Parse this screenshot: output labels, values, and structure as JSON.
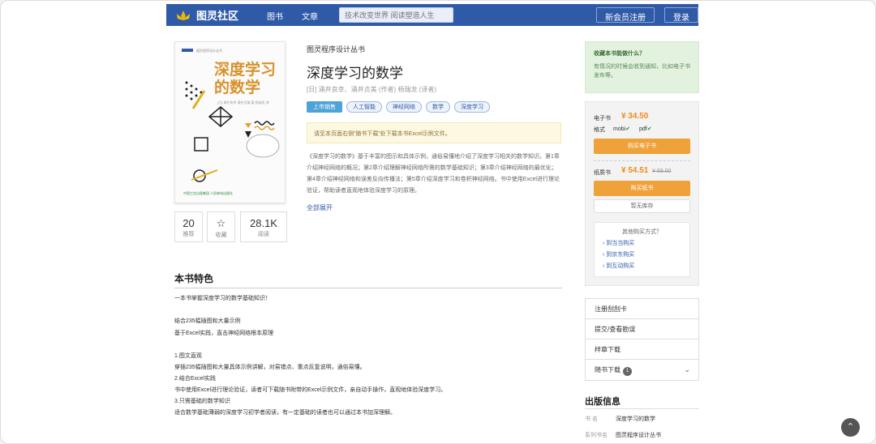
{
  "header": {
    "logo_text": "图灵社区",
    "nav": [
      "图书",
      "文章"
    ],
    "search_placeholder": "技术改变世界 阅读塑造人生",
    "register_label": "新会员注册",
    "login_label": "登录"
  },
  "cover": {
    "series": "图灵程序设计丛书",
    "title_line1": "深度学习",
    "title_line2": "的数学",
    "authors": "[日] 涌井良幸 涌井贞美 著 杨瑞龙 译",
    "publisher": "中国工信出版集团  人民邮电出版社"
  },
  "stats": [
    {
      "value": "20",
      "label": "推荐"
    },
    {
      "value": "☆",
      "label": "收藏"
    },
    {
      "value": "28.1K",
      "label": "阅读"
    }
  ],
  "book": {
    "series": "图灵程序设计丛书",
    "title": "深度学习的数学",
    "authors": "[日] 涌井良幸、涌井贞美 (作者)    杨瑞龙 (译者)",
    "tags": [
      "上市销售",
      "人工智能",
      "神经网络",
      "数学",
      "深度学习"
    ],
    "notice": "请至本页面右侧“随书下载”处下载本书Excel示例文件。",
    "description": "《深度学习的数学》基于丰富的图示和具体示例，通俗易懂地介绍了深度学习相关的数学知识。第1章介绍神经网络的概况；第2章介绍理解神经网络所需的数学基础知识；第3章介绍神经网络的最优化；第4章介绍神经网络和误差反向传播法；第5章介绍深度学习和卷积神经网络。书中使用Excel进行理论验证，帮助读者直观地体验深度学习的原理。",
    "expand_label": "全部展开"
  },
  "features": {
    "title": "本书特色",
    "lines": [
      "一本书掌握深度学习的数学基础知识！",
      "",
      "结合235幅插图和大量示例",
      "基于Excel实践，直击神经网络根本原理",
      "",
      "1.图文直观",
      "穿插235幅插图和大量具体示例讲解，对易错点、重点反复说明，通俗易懂。",
      "2.结合Excel实践",
      "书中使用Excel进行理论验证，读者可下载随书附带的Excel示例文件，亲自动手操作，直观地体验深度学习。",
      "3.只需基础的数学知识",
      "适合数学基础薄弱的深度学习初学者阅读，有一定基础的读者也可以通过本书加深理解。"
    ]
  },
  "tip": {
    "title": "收藏本书能做什么？",
    "text": "有情况的时候会收到通知，比如电子书发布等。"
  },
  "purchase": {
    "ebook_label": "电子书",
    "ebook_price": "¥ 34.50",
    "format_label": "格式",
    "formats": [
      "mobi",
      "pdf"
    ],
    "buy_ebook": "购买电子书",
    "paper_label": "纸质书",
    "paper_price": "¥ 54.51",
    "paper_old_price": "¥ 69.00",
    "buy_paper": "购买纸书",
    "no_stock": "暂无库存",
    "other_title": "其他购买方式？",
    "other_links": [
      "到当当购买",
      "到京东购买",
      "到互动购买"
    ]
  },
  "menu": {
    "items": [
      "注册刮刮卡",
      "提交/查看勘误",
      "样章下载",
      "随书下载"
    ],
    "download_badge": "1"
  },
  "publish": {
    "title": "出版信息",
    "rows": [
      {
        "key": "书    名",
        "value": "深度学习的数学"
      },
      {
        "key": "系列书名",
        "value": "图灵程序设计丛书"
      }
    ]
  },
  "colors": {
    "nav_bg": "#2f5aa8",
    "accent_orange": "#f0a23a",
    "price": "#f08a1c"
  }
}
